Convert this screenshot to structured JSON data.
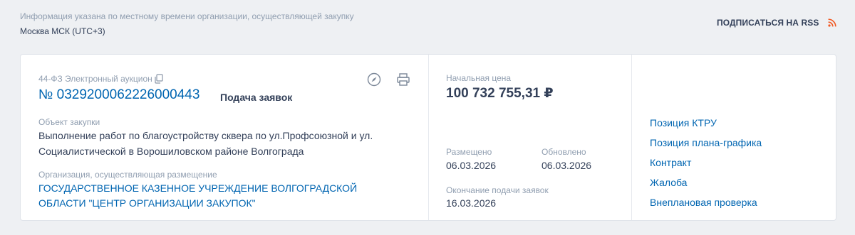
{
  "header": {
    "note": "Информация указана по местному времени организации, осуществляющей закупку",
    "timezone": "Москва МСК (UTC+3)",
    "rss_label": "ПОДПИСАТЬСЯ НА RSS"
  },
  "purchase": {
    "law_type": "44-ФЗ Электронный аукцион",
    "number": "№ 0329200062226000443",
    "status": "Подача заявок",
    "object_label": "Объект закупки",
    "object_text": "Выполнение работ по благоустройству сквера по ул.Профсоюзной и ул. Социалистической в Ворошиловском районе Волгограда",
    "org_label": "Организация, осуществляющая размещение",
    "org_name": "ГОСУДАРСТВЕННОЕ КАЗЕННОЕ УЧРЕЖДЕНИЕ ВОЛГОГРАДСКОЙ ОБЛАСТИ \"ЦЕНТР ОРГАНИЗАЦИИ ЗАКУПОК\""
  },
  "price": {
    "label": "Начальная цена",
    "value": "100 732 755,31 ₽"
  },
  "dates": {
    "placed_label": "Размещено",
    "placed": "06.03.2026",
    "updated_label": "Обновлено",
    "updated": "06.03.2026",
    "end_label": "Окончание подачи заявок",
    "end": "16.03.2026"
  },
  "links": {
    "ktru": "Позиция КТРУ",
    "plan": "Позиция плана-графика",
    "contract": "Контракт",
    "complaint": "Жалоба",
    "inspection": "Внеплановая проверка"
  },
  "colors": {
    "link": "#0065b1",
    "rss": "#f15a24",
    "muted": "#909eb0",
    "text": "#334059",
    "background": "#eef0f3"
  },
  "icons": {
    "rss": "rss-icon",
    "copy": "copy-icon",
    "compass": "compass-icon",
    "print": "print-icon"
  }
}
